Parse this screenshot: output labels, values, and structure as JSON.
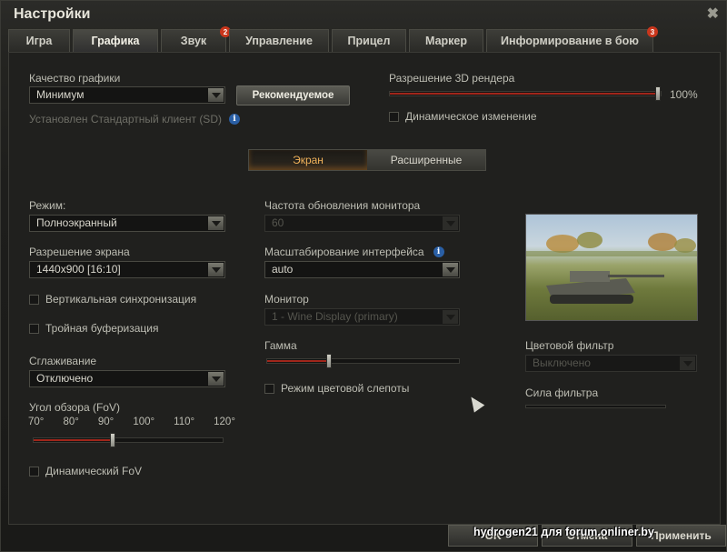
{
  "window": {
    "title": "Настройки",
    "close": "✖"
  },
  "tabs": [
    {
      "label": "Игра",
      "badge": ""
    },
    {
      "label": "Графика",
      "badge": ""
    },
    {
      "label": "Звук",
      "badge": "2"
    },
    {
      "label": "Управление",
      "badge": ""
    },
    {
      "label": "Прицел",
      "badge": ""
    },
    {
      "label": "Маркер",
      "badge": ""
    },
    {
      "label": "Информирование в бою",
      "badge": "3"
    }
  ],
  "quality": {
    "label": "Качество графики",
    "value": "Минимум",
    "recommended_button": "Рекомендуемое",
    "client_info": "Установлен Стандартный клиент (SD)"
  },
  "render": {
    "label": "Разрешение 3D рендера",
    "percent_text": "100%",
    "value": 1.0,
    "dynamic_label": "Динамическое изменение"
  },
  "subtabs": {
    "screen": "Экран",
    "advanced": "Расширенные"
  },
  "left": {
    "mode_label": "Режим:",
    "mode_value": "Полноэкранный",
    "resolution_label": "Разрешение экрана",
    "resolution_value": "1440x900 [16:10]",
    "vsync_label": "Вертикальная синхронизация",
    "triple_label": "Тройная буферизация",
    "aa_label": "Сглаживание",
    "aa_value": "Отключено",
    "fov_label": "Угол обзора (FoV)",
    "fov_ticks": [
      "70°",
      "80°",
      "90°",
      "100°",
      "110°",
      "120°"
    ],
    "fov_value": 0.42,
    "dynamic_fov_label": "Динамический FoV"
  },
  "middle": {
    "refresh_label": "Частота обновления монитора",
    "refresh_value": "60",
    "scale_label": "Масштабирование интерфейса",
    "scale_value": "auto",
    "monitor_label": "Монитор",
    "monitor_value": "1 - Wine Display (primary)",
    "gamma_label": "Гамма",
    "gamma_value": 0.32,
    "colorblind_label": "Режим цветовой слепоты"
  },
  "right": {
    "filter_label": "Цветовой фильтр",
    "filter_value": "Выключено",
    "strength_label": "Сила фильтра"
  },
  "footer": {
    "ok": "OK",
    "cancel": "Отмена",
    "apply": "Применить"
  },
  "watermark": "hydrogen21 для forum.onliner.by",
  "colors": {
    "accent": "#a0261b",
    "subtab_active": "#f3b35a",
    "badge": "#c9361c"
  }
}
